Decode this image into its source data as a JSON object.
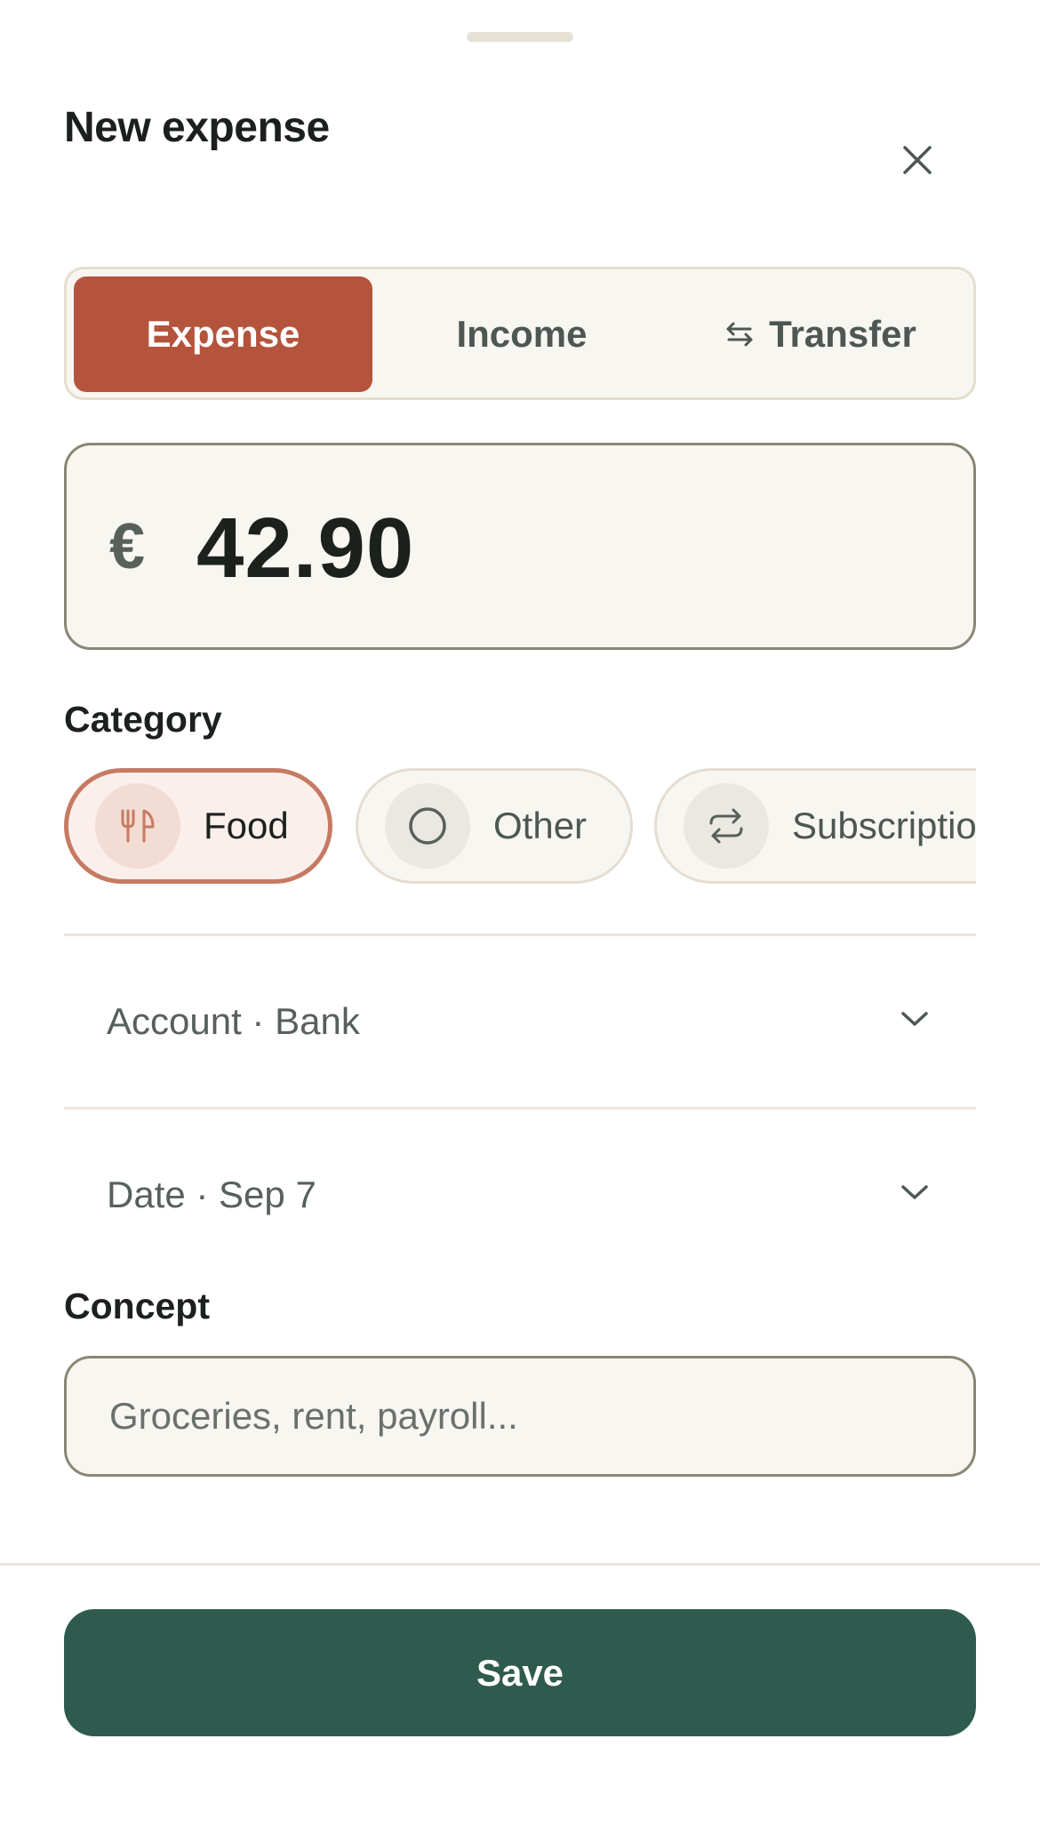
{
  "sheet": {
    "title": "New expense",
    "close_icon": "close-icon"
  },
  "type_switch": {
    "options": [
      {
        "label": "Expense",
        "selected": true
      },
      {
        "label": "Income",
        "selected": false
      },
      {
        "label": "Transfer",
        "selected": false,
        "icon": "swap-arrows-icon"
      }
    ]
  },
  "amount": {
    "currency": "€",
    "value": "42.90"
  },
  "category": {
    "label": "Category",
    "chips": [
      {
        "label": "Food",
        "icon": "fork-knife-icon",
        "selected": true
      },
      {
        "label": "Other",
        "icon": "circle-icon",
        "selected": false
      },
      {
        "label": "Subscriptions",
        "icon": "repeat-icon",
        "selected": false
      }
    ]
  },
  "account": {
    "text": "Account · Bank"
  },
  "date": {
    "text": "Date · Sep 7"
  },
  "concept": {
    "label": "Concept",
    "value": "",
    "placeholder": "Groceries, rent, payroll..."
  },
  "actions": {
    "save_label": "Save"
  },
  "colors": {
    "accent_expense": "#b5543c",
    "primary_button": "#2f5b4e",
    "surface": "#f8f6f0",
    "border": "#8a8675"
  }
}
